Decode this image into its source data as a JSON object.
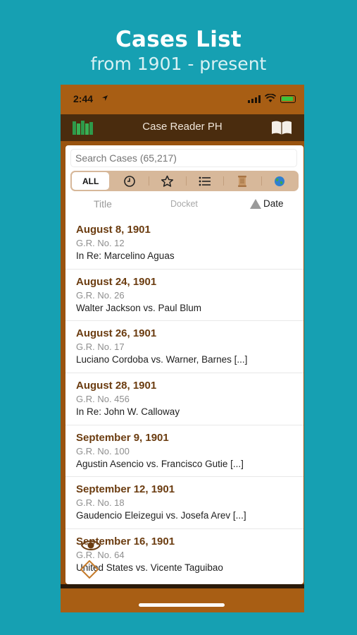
{
  "promo": {
    "title": "Cases List",
    "subtitle": "from 1901 - present"
  },
  "status_bar": {
    "time": "2:44"
  },
  "nav": {
    "title": "Case Reader PH",
    "left_icon": "books-icon",
    "right_icon": "open-book-icon"
  },
  "search": {
    "placeholder": "Search Cases (65,217)"
  },
  "filters": [
    {
      "label": "ALL",
      "icon": "all",
      "active": true
    },
    {
      "label": "",
      "icon": "clock-icon"
    },
    {
      "label": "",
      "icon": "star-icon"
    },
    {
      "label": "",
      "icon": "list-icon"
    },
    {
      "label": "",
      "icon": "scroll-icon"
    },
    {
      "label": "",
      "icon": "globe-icon"
    }
  ],
  "sort": {
    "title": "Title",
    "docket": "Docket",
    "date": "Date"
  },
  "cases": [
    {
      "date": "August 8, 1901",
      "number": "G.R. No. 12",
      "parties": "In Re: Marcelino Aguas"
    },
    {
      "date": "August 24, 1901",
      "number": "G.R. No. 26",
      "parties": "Walter Jackson vs. Paul Blum"
    },
    {
      "date": "August 26, 1901",
      "number": "G.R. No. 17",
      "parties": "Luciano Cordoba vs. Warner, Barnes  [...]"
    },
    {
      "date": "August 28, 1901",
      "number": "G.R. No. 456",
      "parties": "In Re: John W. Calloway"
    },
    {
      "date": "September 9, 1901",
      "number": "G.R. No. 100",
      "parties": "Agustin Asencio vs. Francisco Gutie [...]"
    },
    {
      "date": "September 12, 1901",
      "number": "G.R. No. 18",
      "parties": "Gaudencio Eleizegui vs. Josefa Arev [...]"
    },
    {
      "date": "September 16, 1901",
      "number": "G.R. No. 64",
      "parties": "United States vs. Vicente Taguibao"
    }
  ],
  "colors": {
    "background": "#16a0b2",
    "app_brown": "#a85e14",
    "nav_dark": "#4a2c0e",
    "date_text": "#6b3c10",
    "filter_bar": "#d7b89a"
  }
}
